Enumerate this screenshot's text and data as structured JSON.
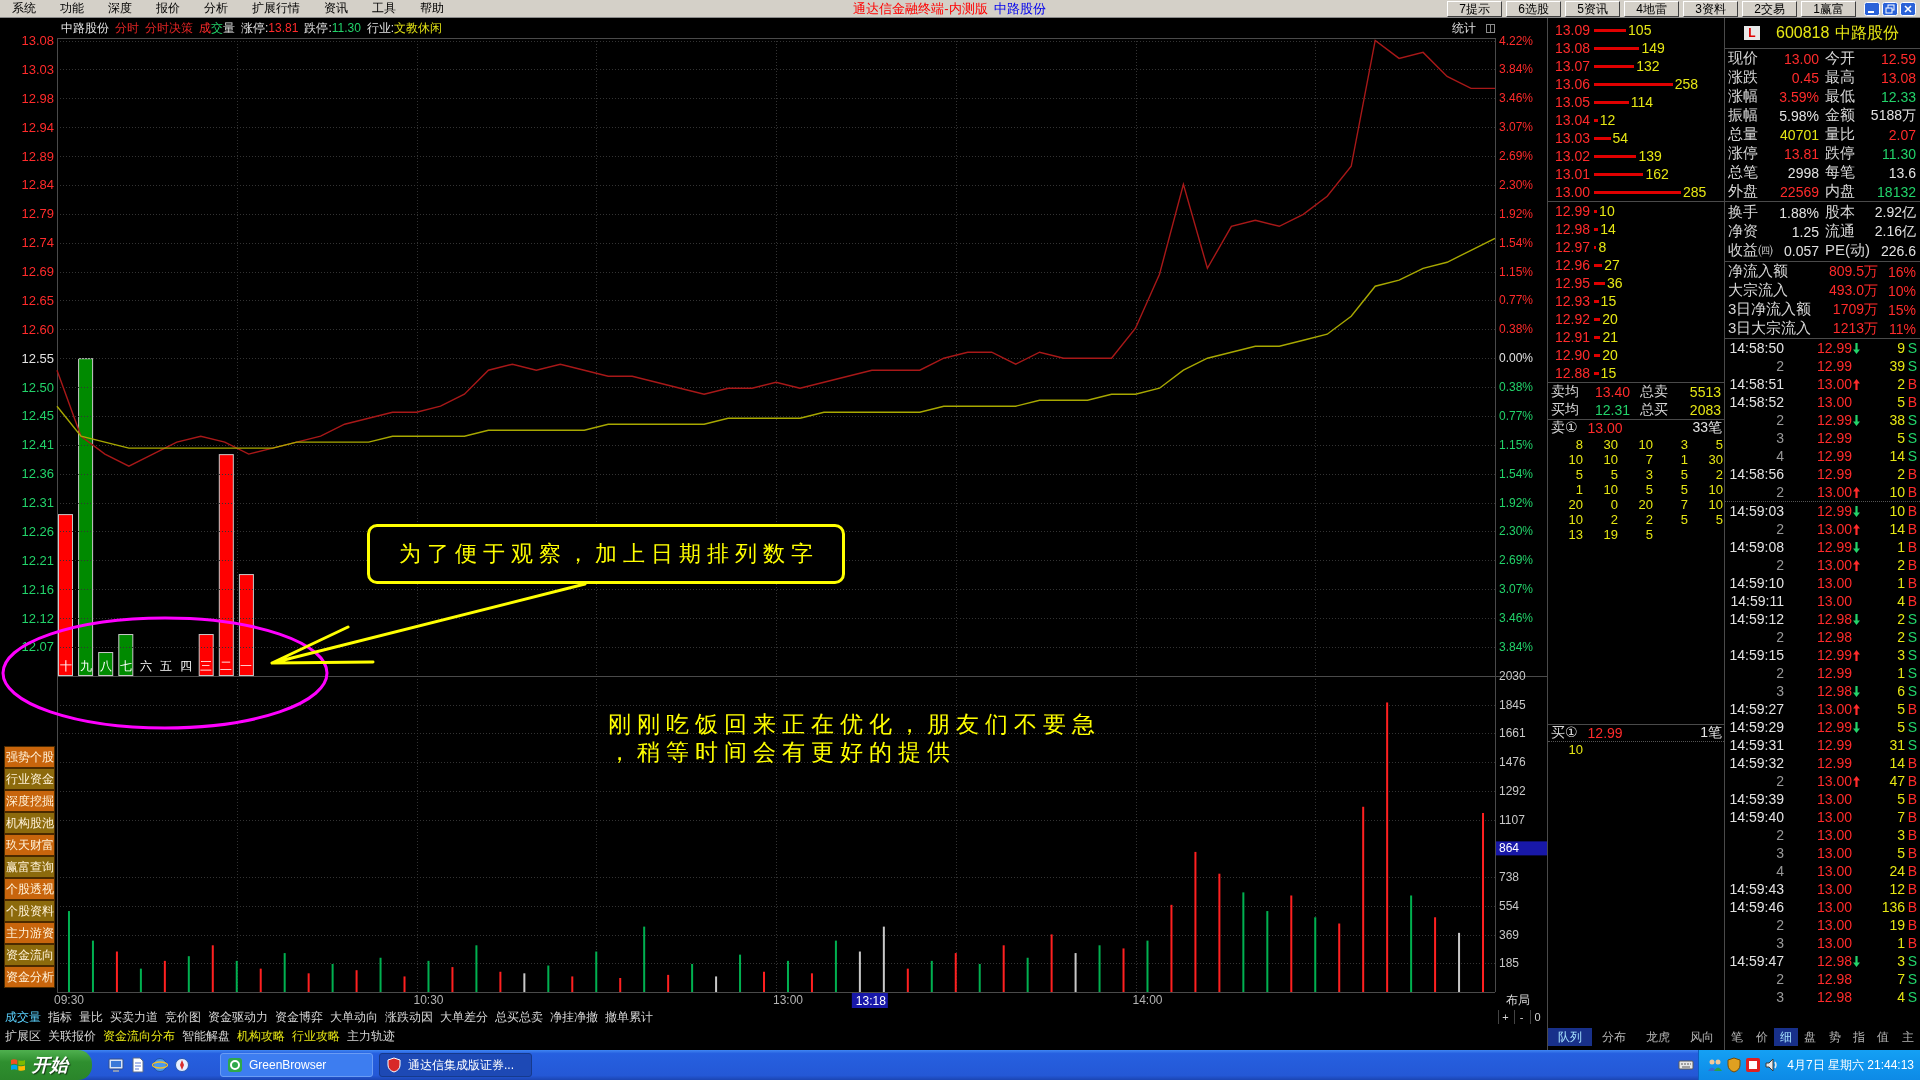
{
  "menu": {
    "items": [
      "系统",
      "功能",
      "深度",
      "报价",
      "分析",
      "扩展行情",
      "资讯",
      "工具",
      "帮助"
    ],
    "title": "通达信金融终端-内测版",
    "stock": "中路股份",
    "shortcuts": [
      "7提示",
      "6选股",
      "5资讯",
      "4地雷",
      "3资料",
      "2交易",
      "1赢富"
    ]
  },
  "chart_header": {
    "name": "中路股份",
    "views": [
      "分时",
      "分时决策"
    ],
    "indicator": [
      {
        "text": "成",
        "kind": "up"
      },
      {
        "text": "交",
        "kind": "down"
      },
      {
        "text": "量",
        "kind": "plain"
      }
    ],
    "limits": [
      {
        "label": "涨停:",
        "value": "13.81",
        "kind": "up"
      },
      {
        "label": "跌停:",
        "value": "11.30",
        "kind": "down"
      },
      {
        "label": "行业:",
        "value": "文教休闲",
        "kind": "info"
      }
    ],
    "stats_label": "统计"
  },
  "price_chart": {
    "percent_axis": [
      {
        "text": "4.22%",
        "kind": "up"
      },
      {
        "text": "3.84%",
        "kind": "up"
      },
      {
        "text": "3.46%",
        "kind": "up"
      },
      {
        "text": "3.07%",
        "kind": "up"
      },
      {
        "text": "2.69%",
        "kind": "up"
      },
      {
        "text": "2.30%",
        "kind": "up"
      },
      {
        "text": "1.92%",
        "kind": "up"
      },
      {
        "text": "1.54%",
        "kind": "up"
      },
      {
        "text": "1.15%",
        "kind": "up"
      },
      {
        "text": "0.77%",
        "kind": "up"
      },
      {
        "text": "0.38%",
        "kind": "up"
      },
      {
        "text": "0.00%",
        "kind": "plain"
      },
      {
        "text": "0.38%",
        "kind": "down"
      },
      {
        "text": "0.77%",
        "kind": "down"
      },
      {
        "text": "1.15%",
        "kind": "down"
      },
      {
        "text": "1.54%",
        "kind": "down"
      },
      {
        "text": "1.92%",
        "kind": "down"
      },
      {
        "text": "2.30%",
        "kind": "down"
      },
      {
        "text": "2.69%",
        "kind": "down"
      },
      {
        "text": "3.07%",
        "kind": "down"
      },
      {
        "text": "3.46%",
        "kind": "down"
      },
      {
        "text": "3.84%",
        "kind": "down"
      }
    ],
    "chart_data": {
      "type": "line",
      "grid": true,
      "categories": [
        null,
        null,
        null,
        null,
        null,
        null,
        null,
        null,
        null,
        null,
        null,
        null,
        null,
        null,
        null,
        null,
        null,
        null,
        null,
        null,
        null,
        null,
        null,
        null,
        null,
        null,
        null,
        null,
        null,
        null,
        null,
        null,
        null,
        null,
        null,
        null,
        null,
        null,
        null,
        null,
        null,
        null,
        null,
        null,
        null,
        null,
        null,
        null,
        null,
        null,
        null,
        null,
        null,
        null,
        null,
        null,
        null,
        null,
        null,
        null,
        null
      ],
      "series": [
        {
          "color": "#a81818",
          "values": [
            12.53,
            12.42,
            12.39,
            12.37,
            12.39,
            12.41,
            12.42,
            12.41,
            12.39,
            12.4,
            12.41,
            12.42,
            12.44,
            12.45,
            12.46,
            12.46,
            12.47,
            12.49,
            12.53,
            12.54,
            12.53,
            12.54,
            12.53,
            12.52,
            12.52,
            12.51,
            12.5,
            12.49,
            12.5,
            12.5,
            12.51,
            12.5,
            12.51,
            12.52,
            12.53,
            12.53,
            12.53,
            12.55,
            12.56,
            12.56,
            12.54,
            12.56,
            12.55,
            12.55,
            12.55,
            12.6,
            12.69,
            12.84,
            12.7,
            12.77,
            12.78,
            12.77,
            12.79,
            12.82,
            12.87,
            13.08,
            13.05,
            13.06,
            13.02,
            13.0,
            13.0
          ]
        },
        {
          "color": "#a8a800",
          "values": [
            12.47,
            12.42,
            12.41,
            12.4,
            12.4,
            12.4,
            12.4,
            12.4,
            12.4,
            12.4,
            12.41,
            12.41,
            12.41,
            12.41,
            12.42,
            12.42,
            12.42,
            12.42,
            12.43,
            12.43,
            12.43,
            12.43,
            12.43,
            12.44,
            12.44,
            12.44,
            12.44,
            12.44,
            12.45,
            12.45,
            12.45,
            12.45,
            12.46,
            12.46,
            12.46,
            12.46,
            12.46,
            12.47,
            12.47,
            12.47,
            12.47,
            12.48,
            12.48,
            12.48,
            12.49,
            12.49,
            12.5,
            12.53,
            12.55,
            12.56,
            12.57,
            12.57,
            12.58,
            12.59,
            12.62,
            12.67,
            12.68,
            12.7,
            12.71,
            12.73,
            12.75
          ]
        }
      ],
      "ylim": [
        12.02,
        13.084
      ],
      "yticks": [
        {
          "value": 13.0796,
          "label": "13.08"
        },
        {
          "value": 13.0315,
          "label": "13.03"
        },
        {
          "value": 12.9833,
          "label": "12.98"
        },
        {
          "value": 12.9352,
          "label": "12.94"
        },
        {
          "value": 12.887,
          "label": "12.89"
        },
        {
          "value": 12.8389,
          "label": "12.84"
        },
        {
          "value": 12.7908,
          "label": "12.79"
        },
        {
          "value": 12.7426,
          "label": "12.74"
        },
        {
          "value": 12.6945,
          "label": "12.69"
        },
        {
          "value": 12.6463,
          "label": "12.65"
        },
        {
          "value": 12.5982,
          "label": "12.60"
        },
        {
          "value": 12.55,
          "label": "12.55"
        },
        {
          "value": 12.5019,
          "label": "12.50"
        },
        {
          "value": 12.4537,
          "label": "12.45"
        },
        {
          "value": 12.4056,
          "label": "12.41"
        },
        {
          "value": 12.3574,
          "label": "12.36"
        },
        {
          "value": 12.3093,
          "label": "12.31"
        },
        {
          "value": 12.2611,
          "label": "12.26"
        },
        {
          "value": 12.213,
          "label": "12.21"
        },
        {
          "value": 12.1648,
          "label": "12.16"
        },
        {
          "value": 12.1167,
          "label": "12.12"
        },
        {
          "value": 12.0685,
          "label": "12.07"
        }
      ]
    }
  },
  "day_bars": {
    "chart_data": {
      "type": "bar",
      "categories": [
        "十",
        "九",
        "八",
        "七",
        "六",
        "五",
        "四",
        "三",
        "二",
        "一"
      ],
      "series": [
        {
          "color": "#ff0000",
          "values": [
            12.29,
            null,
            null,
            null,
            null,
            null,
            null,
            12.09,
            12.39,
            12.19
          ]
        },
        {
          "color": "#008a00",
          "values": [
            null,
            12.55,
            12.06,
            12.09,
            null,
            null,
            null,
            null,
            null,
            null
          ]
        }
      ],
      "stacked": true,
      "ylim": [
        12.02,
        13.084
      ]
    }
  },
  "callout": {
    "text": "为了便于观察，加上日期排列数字"
  },
  "message": {
    "lines": [
      "刚刚吃饭回来正在优化，朋友们不要急",
      "，稍等时间会有更好的提供"
    ]
  },
  "side_buttons": [
    "强势个股",
    "行业资金",
    "深度挖掘",
    "机构股池",
    "玖天财富",
    "赢富查询",
    "个股透视",
    "个股资料",
    "主力游资",
    "资金流向",
    "资金分析"
  ],
  "volume_chart": {
    "corner_label": "布局",
    "cursor_time": "13:18",
    "cursor_value": "864",
    "bars": [
      {
        "color": "#00b050"
      },
      {
        "color": "#00b050"
      },
      {
        "color": "#ff2020"
      },
      {
        "color": "#00b050"
      },
      {
        "color": "#ff2020"
      },
      {
        "color": "#00b050"
      },
      {
        "color": "#ff2020"
      },
      {
        "color": "#00b050"
      },
      {
        "color": "#ff2020"
      },
      {
        "color": "#00b050"
      },
      {
        "color": "#ff2020"
      },
      {
        "color": "#00b050"
      },
      {
        "color": "#ff2020"
      },
      {
        "color": "#00b050"
      },
      {
        "color": "#ff2020"
      },
      {
        "color": "#00b050"
      },
      {
        "color": "#ff2020"
      },
      {
        "color": "#00b050"
      },
      {
        "color": "#ff2020"
      },
      {
        "color": "#c8c8c8"
      },
      {
        "color": "#00b050"
      },
      {
        "color": "#ff2020"
      },
      {
        "color": "#00b050"
      },
      {
        "color": "#ff2020"
      },
      {
        "color": "#00b050"
      },
      {
        "color": "#ff2020"
      },
      {
        "color": "#00b050"
      },
      {
        "color": "#c8c8c8"
      },
      {
        "color": "#00b050"
      },
      {
        "color": "#ff2020"
      },
      {
        "color": "#00b050"
      },
      {
        "color": "#ff2020"
      },
      {
        "color": "#00b050"
      },
      {
        "color": "#c8c8c8"
      },
      {
        "color": "#c8c8c8"
      },
      {
        "color": "#ff2020"
      },
      {
        "color": "#00b050"
      },
      {
        "color": "#ff2020"
      },
      {
        "color": "#00b050"
      },
      {
        "color": "#ff2020"
      },
      {
        "color": "#00b050"
      },
      {
        "color": "#ff2020"
      },
      {
        "color": "#c8c8c8"
      },
      {
        "color": "#00b050"
      },
      {
        "color": "#ff2020"
      },
      {
        "color": "#00b050"
      },
      {
        "color": "#ff2020"
      },
      {
        "color": "#ff2020"
      },
      {
        "color": "#ff2020"
      },
      {
        "color": "#00b050"
      },
      {
        "color": "#00b050"
      },
      {
        "color": "#ff2020"
      },
      {
        "color": "#00b050"
      },
      {
        "color": "#ff2020"
      },
      {
        "color": "#ff2020"
      },
      {
        "color": "#ff2020"
      },
      {
        "color": "#00b050"
      },
      {
        "color": "#ff2020"
      },
      {
        "color": "#c8c8c8"
      },
      {
        "color": "#ff2020"
      }
    ],
    "chart_data": {
      "type": "bar",
      "grid": true,
      "categories": [
        "09:30",
        null,
        null,
        null,
        null,
        null,
        null,
        null,
        null,
        null,
        null,
        null,
        null,
        null,
        null,
        "10:30",
        null,
        null,
        null,
        null,
        null,
        null,
        null,
        null,
        null,
        null,
        null,
        null,
        null,
        null,
        "13:00",
        null,
        null,
        null,
        null,
        null,
        null,
        null,
        null,
        null,
        null,
        null,
        null,
        null,
        null,
        "14:00",
        null,
        null,
        null,
        null,
        null,
        null,
        null,
        null,
        null,
        null,
        null,
        null,
        null,
        null
      ],
      "series": [
        {
          "values": [
            520,
            330,
            260,
            150,
            200,
            230,
            300,
            200,
            150,
            250,
            120,
            180,
            140,
            220,
            100,
            200,
            160,
            300,
            130,
            120,
            170,
            100,
            260,
            90,
            420,
            110,
            180,
            100,
            240,
            130,
            200,
            120,
            330,
            260,
            420,
            150,
            200,
            250,
            180,
            300,
            220,
            370,
            250,
            300,
            280,
            330,
            560,
            900,
            760,
            640,
            520,
            620,
            480,
            440,
            1190,
            1860,
            620,
            480,
            380,
            1150
          ]
        }
      ],
      "ylim": [
        0,
        2030
      ],
      "yticks": [
        2030,
        1845,
        1661,
        1476,
        1292,
        1107,
        738,
        554,
        369,
        185
      ]
    }
  },
  "bottom_tabs": {
    "indicators": [
      {
        "label": "成交量",
        "selected": true
      },
      {
        "label": "指标",
        "selected": false
      },
      {
        "label": "量比",
        "selected": false
      },
      {
        "label": "买卖力道",
        "selected": false
      },
      {
        "label": "竞价图",
        "selected": false
      },
      {
        "label": "资金驱动力",
        "selected": false
      },
      {
        "label": "资金博弈",
        "selected": false
      },
      {
        "label": "大单动向",
        "selected": false
      },
      {
        "label": "涨跌动因",
        "selected": false
      },
      {
        "label": "大单差分",
        "selected": false
      },
      {
        "label": "总买总卖",
        "selected": false
      },
      {
        "label": "净挂净撤",
        "selected": false
      },
      {
        "label": "撤单累计",
        "selected": false
      }
    ],
    "zoom_buttons": [
      "+",
      "-",
      "0"
    ],
    "extensions": [
      {
        "label": "扩展区",
        "highlighted": false
      },
      {
        "label": "关联报价",
        "highlighted": false
      },
      {
        "label": "资金流向分布",
        "highlighted": true
      },
      {
        "label": "智能解盘",
        "highlighted": false
      },
      {
        "label": "机构攻略",
        "highlighted": true
      },
      {
        "label": "行业攻略",
        "highlighted": true
      },
      {
        "label": "主力轨迹",
        "highlighted": false
      }
    ]
  },
  "order_book": {
    "asks": [
      {
        "price": "13.09",
        "volume": "105"
      },
      {
        "price": "13.08",
        "volume": "149"
      },
      {
        "price": "13.07",
        "volume": "132"
      },
      {
        "price": "13.06",
        "volume": "258"
      },
      {
        "price": "13.05",
        "volume": "114"
      },
      {
        "price": "13.04",
        "volume": "12"
      },
      {
        "price": "13.03",
        "volume": "54"
      },
      {
        "price": "13.02",
        "volume": "139"
      },
      {
        "price": "13.01",
        "volume": "162"
      },
      {
        "price": "13.00",
        "volume": "285"
      }
    ],
    "bids": [
      {
        "price": "12.99",
        "volume": "10"
      },
      {
        "price": "12.98",
        "volume": "14"
      },
      {
        "price": "12.97",
        "volume": "8"
      },
      {
        "price": "12.96",
        "volume": "27"
      },
      {
        "price": "12.95",
        "volume": "36"
      },
      {
        "price": "12.93",
        "volume": "15"
      },
      {
        "price": "12.92",
        "volume": "20"
      },
      {
        "price": "12.91",
        "volume": "21"
      },
      {
        "price": "12.90",
        "volume": "20"
      },
      {
        "price": "12.88",
        "volume": "15"
      }
    ],
    "averages": [
      {
        "label": "卖均",
        "value": "13.40",
        "kind": "up",
        "total_label": "总卖",
        "total": "5513"
      },
      {
        "label": "买均",
        "value": "12.31",
        "kind": "down",
        "total_label": "总买",
        "total": "2083"
      }
    ],
    "ask_queue": {
      "label": "卖①",
      "price": "13.00",
      "count": "33笔",
      "rows": [
        [
          "8",
          "30",
          "10",
          "3",
          "5"
        ],
        [
          "10",
          "10",
          "7",
          "1",
          "30"
        ],
        [
          "5",
          "5",
          "3",
          "5",
          "2"
        ],
        [
          "1",
          "10",
          "5",
          "5",
          "10"
        ],
        [
          "20",
          "0",
          "20",
          "7",
          "10"
        ],
        [
          "10",
          "2",
          "2",
          "5",
          "5"
        ],
        [
          "13",
          "19",
          "5"
        ]
      ]
    },
    "bid_queue": {
      "label": "买①",
      "price": "12.99",
      "count": "1笔",
      "rows": [
        [
          "10"
        ]
      ]
    },
    "tabs": [
      {
        "label": "队列",
        "selected": true
      },
      {
        "label": "分布",
        "selected": false
      },
      {
        "label": "龙虎",
        "selected": false
      },
      {
        "label": "风向",
        "selected": false
      }
    ]
  },
  "quote": {
    "badge": "L",
    "code": "600818",
    "name": "中路股份",
    "fields": [
      {
        "label": "现价",
        "value": "13.00",
        "kind": "up"
      },
      {
        "label": "今开",
        "value": "12.59",
        "kind": "up"
      },
      {
        "label": "涨跌",
        "value": "0.45",
        "kind": "up"
      },
      {
        "label": "最高",
        "value": "13.08",
        "kind": "up"
      },
      {
        "label": "涨幅",
        "value": "3.59%",
        "kind": "up"
      },
      {
        "label": "最低",
        "value": "12.33",
        "kind": "down"
      },
      {
        "label": "振幅",
        "value": "5.98%",
        "kind": "plain"
      },
      {
        "label": "金额",
        "value": "5188万",
        "kind": "plain"
      },
      {
        "label": "总量",
        "value": "40701",
        "kind": "info"
      },
      {
        "label": "量比",
        "value": "2.07",
        "kind": "up"
      },
      {
        "label": "涨停",
        "value": "13.81",
        "kind": "up"
      },
      {
        "label": "跌停",
        "value": "11.30",
        "kind": "down"
      },
      {
        "label": "总笔",
        "value": "2998",
        "kind": "plain"
      },
      {
        "label": "每笔",
        "value": "13.6",
        "kind": "plain"
      },
      {
        "label": "外盘",
        "value": "22569",
        "kind": "up"
      },
      {
        "label": "内盘",
        "value": "18132",
        "kind": "down"
      }
    ],
    "stats": [
      {
        "label": "换手",
        "value": "1.88%"
      },
      {
        "label": "股本",
        "value": "2.92亿"
      },
      {
        "label": "净资",
        "value": "1.25"
      },
      {
        "label": "流通",
        "value": "2.16亿"
      },
      {
        "label": "收益㈣",
        "value": "0.057"
      },
      {
        "label": "PE(动)",
        "value": "226.6"
      }
    ],
    "flows": [
      {
        "label": "净流入额",
        "value": "809.5万",
        "share": "16%",
        "kind": "up"
      },
      {
        "label": "大宗流入",
        "value": "493.0万",
        "share": "10%",
        "kind": "up"
      },
      {
        "label": "3日净流入额",
        "value": "1709万",
        "share": "15%",
        "kind": "up"
      },
      {
        "label": "3日大宗流入",
        "value": "1213万",
        "share": "11%",
        "kind": "up"
      }
    ]
  },
  "trades": {
    "groups": [
      {
        "rows": [
          {
            "stamp": "14:58:50",
            "sequel": false,
            "price": "12.99",
            "uptick": false,
            "downtick": true,
            "volume": "9",
            "side": "S",
            "kind": "sell"
          },
          {
            "stamp": "2",
            "sequel": true,
            "price": "12.99",
            "uptick": false,
            "downtick": false,
            "volume": "39",
            "side": "S",
            "kind": "sell"
          },
          {
            "stamp": "14:58:51",
            "sequel": false,
            "price": "13.00",
            "uptick": true,
            "downtick": false,
            "volume": "2",
            "side": "B",
            "kind": "buy"
          },
          {
            "stamp": "14:58:52",
            "sequel": false,
            "price": "13.00",
            "uptick": false,
            "downtick": false,
            "volume": "5",
            "side": "B",
            "kind": "buy"
          },
          {
            "stamp": "2",
            "sequel": true,
            "price": "12.99",
            "uptick": false,
            "downtick": true,
            "volume": "38",
            "side": "S",
            "kind": "sell"
          },
          {
            "stamp": "3",
            "sequel": true,
            "price": "12.99",
            "uptick": false,
            "downtick": false,
            "volume": "5",
            "side": "S",
            "kind": "sell"
          },
          {
            "stamp": "4",
            "sequel": true,
            "price": "12.99",
            "uptick": false,
            "downtick": false,
            "volume": "14",
            "side": "S",
            "kind": "sell"
          },
          {
            "stamp": "14:58:56",
            "sequel": false,
            "price": "12.99",
            "uptick": false,
            "downtick": false,
            "volume": "2",
            "side": "B",
            "kind": "buy"
          },
          {
            "stamp": "2",
            "sequel": true,
            "price": "13.00",
            "uptick": true,
            "downtick": false,
            "volume": "10",
            "side": "B",
            "kind": "buy"
          }
        ]
      },
      {
        "rows": [
          {
            "stamp": "14:59:03",
            "sequel": false,
            "price": "12.99",
            "uptick": false,
            "downtick": true,
            "volume": "10",
            "side": "B",
            "kind": "buy"
          },
          {
            "stamp": "2",
            "sequel": true,
            "price": "13.00",
            "uptick": true,
            "downtick": false,
            "volume": "14",
            "side": "B",
            "kind": "buy"
          },
          {
            "stamp": "14:59:08",
            "sequel": false,
            "price": "12.99",
            "uptick": false,
            "downtick": true,
            "volume": "1",
            "side": "B",
            "kind": "buy"
          },
          {
            "stamp": "2",
            "sequel": true,
            "price": "13.00",
            "uptick": true,
            "downtick": false,
            "volume": "2",
            "side": "B",
            "kind": "buy"
          },
          {
            "stamp": "14:59:10",
            "sequel": false,
            "price": "13.00",
            "uptick": false,
            "downtick": false,
            "volume": "1",
            "side": "B",
            "kind": "buy"
          },
          {
            "stamp": "14:59:11",
            "sequel": false,
            "price": "13.00",
            "uptick": false,
            "downtick": false,
            "volume": "4",
            "side": "B",
            "kind": "buy"
          },
          {
            "stamp": "14:59:12",
            "sequel": false,
            "price": "12.98",
            "uptick": false,
            "downtick": true,
            "volume": "2",
            "side": "S",
            "kind": "sell"
          },
          {
            "stamp": "2",
            "sequel": true,
            "price": "12.98",
            "uptick": false,
            "downtick": false,
            "volume": "2",
            "side": "S",
            "kind": "sell"
          },
          {
            "stamp": "14:59:15",
            "sequel": false,
            "price": "12.99",
            "uptick": true,
            "downtick": false,
            "volume": "3",
            "side": "S",
            "kind": "sell"
          },
          {
            "stamp": "2",
            "sequel": true,
            "price": "12.99",
            "uptick": false,
            "downtick": false,
            "volume": "1",
            "side": "S",
            "kind": "sell"
          },
          {
            "stamp": "3",
            "sequel": true,
            "price": "12.98",
            "uptick": false,
            "downtick": true,
            "volume": "6",
            "side": "S",
            "kind": "sell"
          },
          {
            "stamp": "14:59:27",
            "sequel": false,
            "price": "13.00",
            "uptick": true,
            "downtick": false,
            "volume": "5",
            "side": "B",
            "kind": "buy"
          },
          {
            "stamp": "14:59:29",
            "sequel": false,
            "price": "12.99",
            "uptick": false,
            "downtick": true,
            "volume": "5",
            "side": "S",
            "kind": "sell"
          },
          {
            "stamp": "14:59:31",
            "sequel": false,
            "price": "12.99",
            "uptick": false,
            "downtick": false,
            "volume": "31",
            "side": "S",
            "kind": "sell"
          },
          {
            "stamp": "14:59:32",
            "sequel": false,
            "price": "12.99",
            "uptick": false,
            "downtick": false,
            "volume": "14",
            "side": "B",
            "kind": "buy"
          },
          {
            "stamp": "2",
            "sequel": true,
            "price": "13.00",
            "uptick": true,
            "downtick": false,
            "volume": "47",
            "side": "B",
            "kind": "buy"
          },
          {
            "stamp": "14:59:39",
            "sequel": false,
            "price": "13.00",
            "uptick": false,
            "downtick": false,
            "volume": "5",
            "side": "B",
            "kind": "buy"
          },
          {
            "stamp": "14:59:40",
            "sequel": false,
            "price": "13.00",
            "uptick": false,
            "downtick": false,
            "volume": "7",
            "side": "B",
            "kind": "buy"
          },
          {
            "stamp": "2",
            "sequel": true,
            "price": "13.00",
            "uptick": false,
            "downtick": false,
            "volume": "3",
            "side": "B",
            "kind": "buy"
          },
          {
            "stamp": "3",
            "sequel": true,
            "price": "13.00",
            "uptick": false,
            "downtick": false,
            "volume": "5",
            "side": "B",
            "kind": "buy"
          },
          {
            "stamp": "4",
            "sequel": true,
            "price": "13.00",
            "uptick": false,
            "downtick": false,
            "volume": "24",
            "side": "B",
            "kind": "buy"
          },
          {
            "stamp": "14:59:43",
            "sequel": false,
            "price": "13.00",
            "uptick": false,
            "downtick": false,
            "volume": "12",
            "side": "B",
            "kind": "buy"
          },
          {
            "stamp": "14:59:46",
            "sequel": false,
            "price": "13.00",
            "uptick": false,
            "downtick": false,
            "volume": "136",
            "side": "B",
            "kind": "buy"
          },
          {
            "stamp": "2",
            "sequel": true,
            "price": "13.00",
            "uptick": false,
            "downtick": false,
            "volume": "19",
            "side": "B",
            "kind": "buy"
          },
          {
            "stamp": "3",
            "sequel": true,
            "price": "13.00",
            "uptick": false,
            "downtick": false,
            "volume": "1",
            "side": "B",
            "kind": "buy"
          },
          {
            "stamp": "14:59:47",
            "sequel": false,
            "price": "12.98",
            "uptick": false,
            "downtick": true,
            "volume": "3",
            "side": "S",
            "kind": "sell"
          },
          {
            "stamp": "2",
            "sequel": true,
            "price": "12.98",
            "uptick": false,
            "downtick": false,
            "volume": "7",
            "side": "S",
            "kind": "sell"
          },
          {
            "stamp": "3",
            "sequel": true,
            "price": "12.98",
            "uptick": false,
            "downtick": false,
            "volume": "4",
            "side": "S",
            "kind": "sell"
          }
        ]
      }
    ]
  },
  "detail_tabs": [
    {
      "label": "笔",
      "selected": false
    },
    {
      "label": "价",
      "selected": false
    },
    {
      "label": "细",
      "selected": true
    },
    {
      "label": "盘",
      "selected": false
    },
    {
      "label": "势",
      "selected": false
    },
    {
      "label": "指",
      "selected": false
    },
    {
      "label": "值",
      "selected": false
    },
    {
      "label": "主",
      "selected": false
    }
  ],
  "taskbar": {
    "start_label": "开始",
    "tasks": [
      {
        "label": "GreenBrowser",
        "selected": false
      },
      {
        "label": "通达信集成版证券...",
        "selected": true
      }
    ],
    "clock": "4月7日 星期六 21:44:13"
  }
}
